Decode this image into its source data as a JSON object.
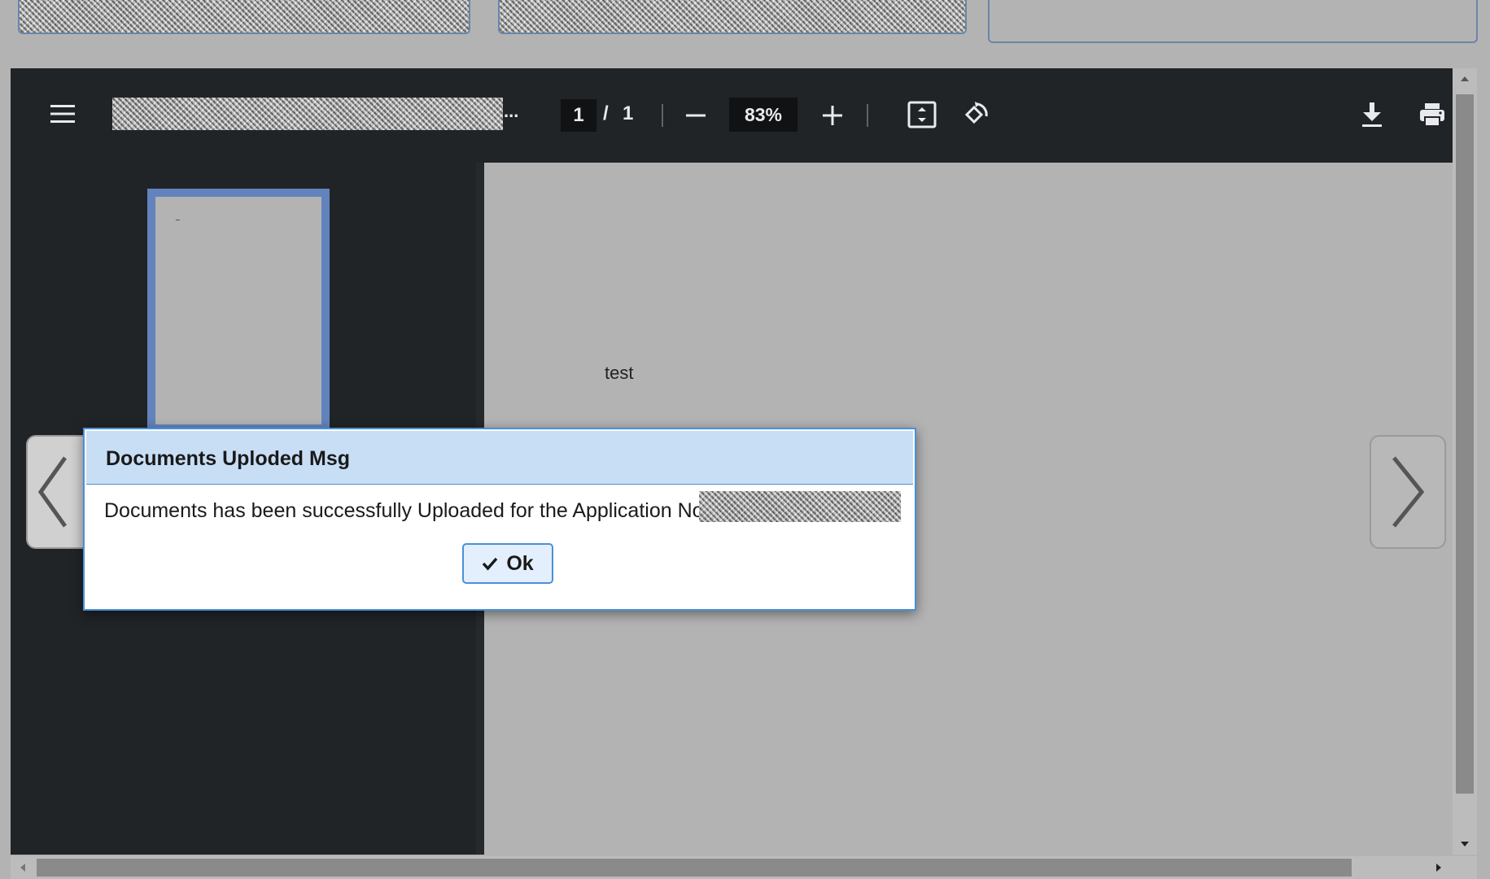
{
  "viewer": {
    "page_current": "1",
    "page_separator": "/",
    "page_total": "1",
    "zoom": "83%",
    "title_ellipsis": "..."
  },
  "document": {
    "text": "test"
  },
  "dialog": {
    "title": "Documents Uploded Msg",
    "message": "Documents has been successfully Uploaded for the Application No",
    "ok_label": "Ok"
  },
  "icons": {
    "menu": "menu-icon",
    "zoom_out": "minus-icon",
    "zoom_in": "plus-icon",
    "fit": "fit-to-page-icon",
    "rotate": "rotate-icon",
    "download": "download-icon",
    "print": "print-icon",
    "prev": "chevron-left-icon",
    "next": "chevron-right-icon",
    "ok": "check-icon"
  },
  "colors": {
    "toolbar_bg": "#202427",
    "dialog_header_bg": "#c8def5",
    "dialog_border": "#4a90d9",
    "thumbnail_border": "#6283bd"
  }
}
